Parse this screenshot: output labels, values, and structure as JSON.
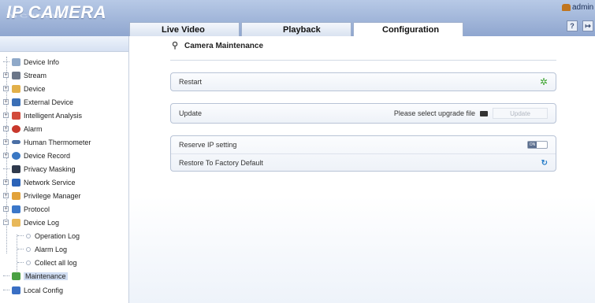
{
  "header": {
    "logo": "IP CAMERA",
    "user": "admin",
    "tabs": [
      {
        "label": "Live Video"
      },
      {
        "label": "Playback"
      },
      {
        "label": "Configuration"
      }
    ],
    "buttons": [
      {
        "icon": "help-icon"
      },
      {
        "icon": "logout-icon"
      }
    ]
  },
  "sidebar": {
    "items": [
      {
        "label": "Device Info",
        "icon": "device-info-icon",
        "color": "#8fa9c9"
      },
      {
        "label": "Stream",
        "icon": "stream-icon",
        "color": "#6b7688"
      },
      {
        "label": "Device",
        "icon": "device-icon",
        "color": "#e2b04a"
      },
      {
        "label": "External Device",
        "icon": "external-device-icon",
        "color": "#3b6fb6"
      },
      {
        "label": "Intelligent Analysis",
        "icon": "intelligent-analysis-icon",
        "color": "#d24a3a"
      },
      {
        "label": "Alarm",
        "icon": "alarm-icon",
        "color": "#c8382c"
      },
      {
        "label": "Human Thermometer",
        "icon": "thermometer-icon",
        "color": "#4a6fa5"
      },
      {
        "label": "Device Record",
        "icon": "device-record-icon",
        "color": "#3a78c4"
      },
      {
        "label": "Privacy Masking",
        "icon": "privacy-masking-icon",
        "color": "#2f3a4d"
      },
      {
        "label": "Network Service",
        "icon": "network-service-icon",
        "color": "#2b63b8"
      },
      {
        "label": "Privilege Manager",
        "icon": "privilege-manager-icon",
        "color": "#e2a23a"
      },
      {
        "label": "Protocol",
        "icon": "protocol-icon",
        "color": "#3b77c9"
      },
      {
        "label": "Device Log",
        "icon": "device-log-icon",
        "color": "#e8b85a"
      },
      {
        "label": "Operation Log",
        "icon": "log-dot-icon"
      },
      {
        "label": "Alarm Log",
        "icon": "log-dot-icon"
      },
      {
        "label": "Collect all log",
        "icon": "log-dot-icon"
      },
      {
        "label": "Maintenance",
        "icon": "maintenance-icon",
        "color": "#4aa043"
      },
      {
        "label": "Local Config",
        "icon": "local-config-icon",
        "color": "#3a6fc4"
      }
    ]
  },
  "main": {
    "title": "Camera Maintenance",
    "restart": {
      "label": "Restart"
    },
    "update": {
      "label": "Update",
      "hint": "Please select upgrade file",
      "button": "Update"
    },
    "reserve_ip": {
      "label": "Reserve IP setting",
      "toggle": "ON"
    },
    "factory": {
      "label": "Restore To Factory Default"
    }
  }
}
